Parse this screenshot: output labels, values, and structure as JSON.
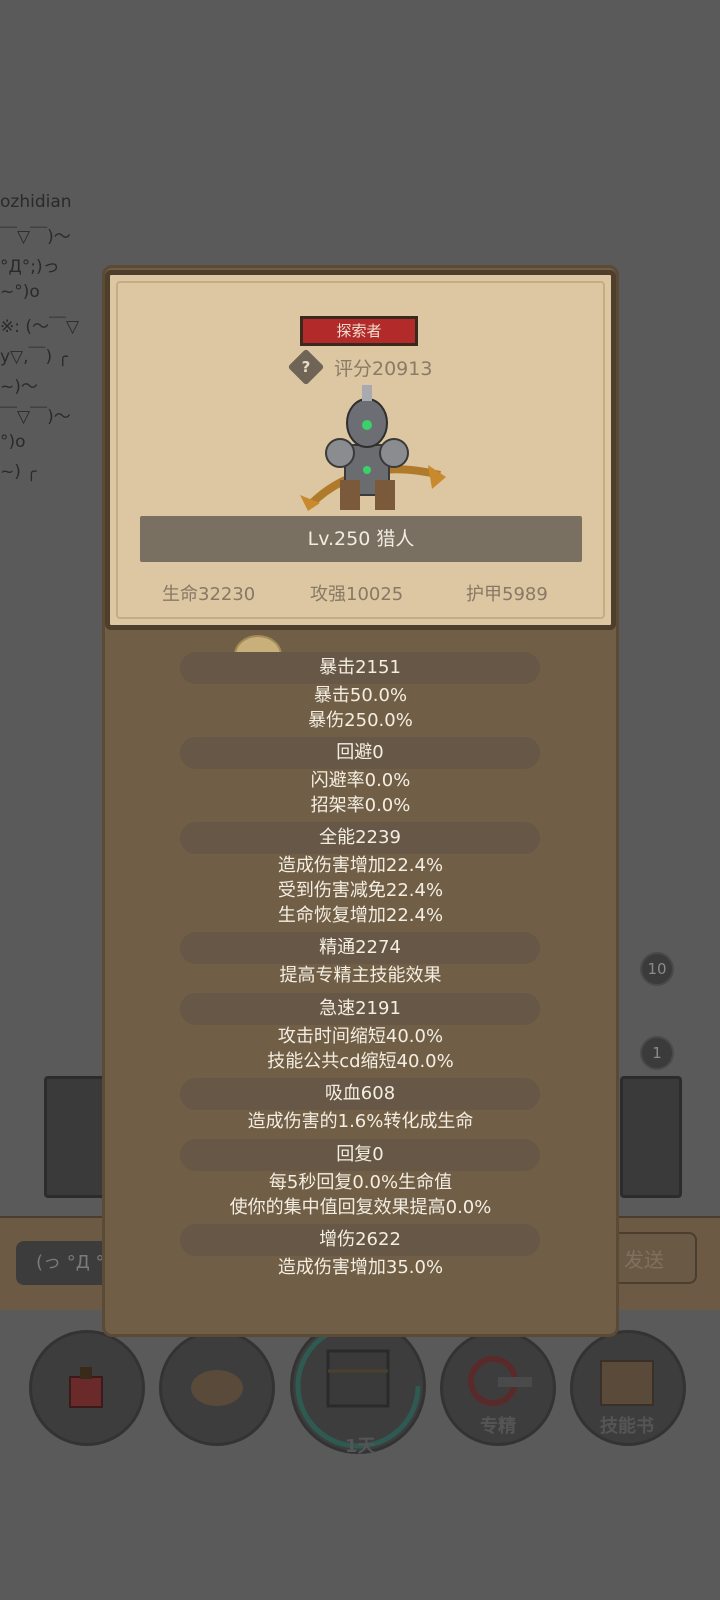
{
  "background": {
    "chat_lines": [
      "ozhidian",
      "￣▽￣)～",
      "°Д°;)っ",
      "~°)o",
      "※: (～￣▽",
      "y▽,￣) ╭",
      "~)～",
      "￣▽￣)～",
      "°)o",
      "~) ╭"
    ],
    "badge_top": "10",
    "badge_bottom": "1",
    "chat_input_placeholder": "(っ °Д °",
    "send_label": "发送",
    "bottom_labels": {
      "slot3": "1天",
      "slot4": "专精",
      "slot5": "技能书"
    }
  },
  "character": {
    "class_tag": "探索者",
    "score": "评分20913",
    "help_glyph": "?",
    "level": "Lv.250 猎人",
    "hp": "生命32230",
    "attack": "攻强10025",
    "armor": "护甲5989"
  },
  "stats": [
    {
      "header": "暴击2151",
      "lines": [
        "暴击50.0%",
        "暴伤250.0%"
      ]
    },
    {
      "header": "回避0",
      "lines": [
        "闪避率0.0%",
        "招架率0.0%"
      ]
    },
    {
      "header": "全能2239",
      "lines": [
        "造成伤害增加22.4%",
        "受到伤害减免22.4%",
        "生命恢复增加22.4%"
      ]
    },
    {
      "header": "精通2274",
      "lines": [
        "提高专精主技能效果"
      ]
    },
    {
      "header": "急速2191",
      "lines": [
        "攻击时间缩短40.0%",
        "技能公共cd缩短40.0%"
      ]
    },
    {
      "header": "吸血608",
      "lines": [
        "造成伤害的1.6%转化成生命"
      ]
    },
    {
      "header": "回复0",
      "lines": [
        "每5秒回复0.0%生命值",
        "使你的集中值回复效果提高0.0%"
      ]
    },
    {
      "header": "增伤2622",
      "lines": [
        "造成伤害增加35.0%"
      ]
    }
  ]
}
